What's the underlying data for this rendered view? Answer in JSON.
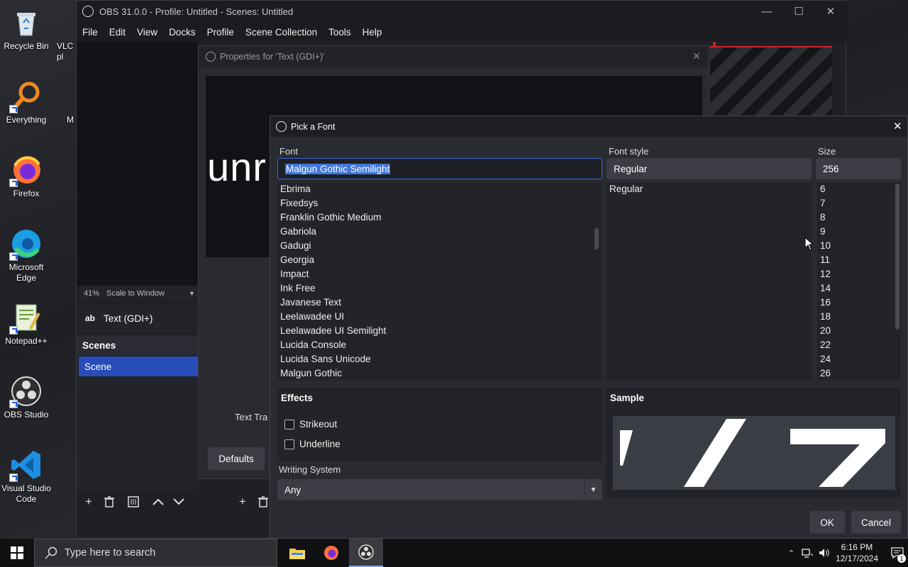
{
  "desktop": {
    "icons": [
      {
        "label": "Recycle Bin",
        "icon": "recycle-bin-icon"
      },
      {
        "label": "Everything",
        "icon": "search-magnifier-icon"
      },
      {
        "label": "Firefox",
        "icon": "firefox-icon"
      },
      {
        "label": "Microsoft Edge",
        "icon": "edge-icon"
      },
      {
        "label": "Notepad++",
        "icon": "notepadpp-icon"
      },
      {
        "label": "OBS Studio",
        "icon": "obs-icon"
      },
      {
        "label": "Visual Studio Code",
        "icon": "vscode-icon"
      }
    ],
    "partial_icons": [
      {
        "label": "VLC\npl",
        "icon": "vlc-icon"
      },
      {
        "label": "M",
        "icon": "app-icon"
      }
    ]
  },
  "obs": {
    "title": "OBS 31.0.0 - Profile: Untitled - Scenes: Untitled",
    "menu": [
      "File",
      "Edit",
      "View",
      "Docks",
      "Profile",
      "Scene Collection",
      "Tools",
      "Help"
    ],
    "zoom": "41%",
    "scale_mode": "Scale to Window",
    "source_type_icon": "ab",
    "source_name": "Text (GDI+)",
    "scenes_header": "Scenes",
    "scenes": [
      "Scene"
    ]
  },
  "properties": {
    "title": "Properties for 'Text (GDI+)'",
    "preview_text": "unr",
    "label_partial": "Text Tra",
    "defaults_label": "Defaults"
  },
  "font_dialog": {
    "title": "Pick a Font",
    "font_label": "Font",
    "font_value": "Malgun Gothic Semilight",
    "style_label": "Font style",
    "style_value": "Regular",
    "size_label": "Size",
    "size_value": "256",
    "fonts": [
      "Ebrima",
      "Fixedsys",
      "Franklin Gothic Medium",
      "Gabriola",
      "Gadugi",
      "Georgia",
      "Impact",
      "Ink Free",
      "Javanese Text",
      "Leelawadee UI",
      "Leelawadee UI Semilight",
      "Lucida Console",
      "Lucida Sans Unicode",
      "Malgun Gothic"
    ],
    "styles": [
      "Regular"
    ],
    "sizes": [
      "6",
      "7",
      "8",
      "9",
      "10",
      "11",
      "12",
      "14",
      "16",
      "18",
      "20",
      "22",
      "24",
      "26"
    ],
    "effects_title": "Effects",
    "strikeout_label": "Strikeout",
    "strikeout_checked": false,
    "underline_label": "Underline",
    "underline_checked": false,
    "writing_system_label": "Writing System",
    "writing_system_value": "Any",
    "sample_title": "Sample",
    "ok_label": "OK",
    "cancel_label": "Cancel"
  },
  "taskbar": {
    "search_placeholder": "Type here to search",
    "time": "6:16 PM",
    "date": "12/17/2024",
    "notification_count": "1",
    "pinned": [
      "file-explorer-icon",
      "firefox-icon",
      "obs-icon"
    ]
  }
}
